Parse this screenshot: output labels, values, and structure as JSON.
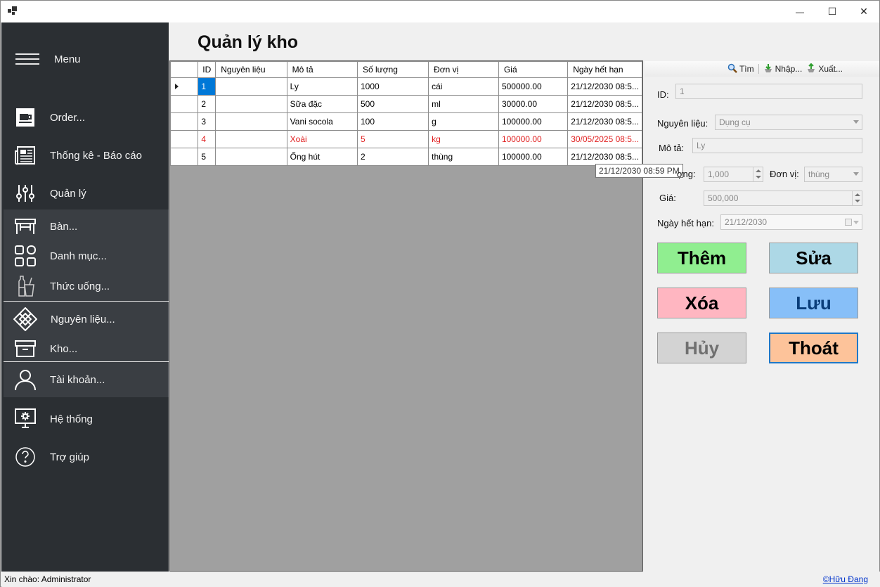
{
  "window": {
    "minimize": "—",
    "maximize": "☐",
    "close": "✕"
  },
  "sidebar": {
    "menu_label": "Menu",
    "items": [
      {
        "label": "Order...",
        "icon": "coffee-cup-icon"
      },
      {
        "label": "Thống kê - Báo cáo",
        "icon": "newspaper-icon"
      },
      {
        "label": "Quản lý",
        "icon": "sliders-icon"
      },
      {
        "label": "Bàn...",
        "icon": "table-icon"
      },
      {
        "label": "Danh mục...",
        "icon": "grid-apps-icon"
      },
      {
        "label": "Thức uống...",
        "icon": "drinks-icon"
      },
      {
        "label": "Nguyên liệu...",
        "icon": "ingredients-icon"
      },
      {
        "label": "Kho...",
        "icon": "archive-box-icon"
      },
      {
        "label": "Tài khoản...",
        "icon": "user-icon"
      },
      {
        "label": "Hệ thống",
        "icon": "system-monitor-icon"
      },
      {
        "label": "Trợ giúp",
        "icon": "help-circle-icon"
      }
    ]
  },
  "page_title": "Quản lý kho",
  "grid": {
    "columns": [
      "ID",
      "Nguyên liệu",
      "Mô tả",
      "Số lượng",
      "Đơn vị",
      "Giá",
      "Ngày hết hạn"
    ],
    "rows": [
      {
        "id": "1",
        "ingredient": "",
        "desc": "Ly",
        "qty": "1000",
        "unit": "cái",
        "price": "500000.00",
        "expiry": "21/12/2030 08:5...",
        "expired": false,
        "selected": true
      },
      {
        "id": "2",
        "ingredient": "",
        "desc": "Sữa đặc",
        "qty": "500",
        "unit": "ml",
        "price": "30000.00",
        "expiry": "21/12/2030 08:5...",
        "expired": false,
        "selected": false
      },
      {
        "id": "3",
        "ingredient": "",
        "desc": "Vani socola",
        "qty": "100",
        "unit": "g",
        "price": "100000.00",
        "expiry": "21/12/2030 08:5...",
        "expired": false,
        "selected": false
      },
      {
        "id": "4",
        "ingredient": "",
        "desc": "Xoài",
        "qty": "5",
        "unit": "kg",
        "price": "100000.00",
        "expiry": "30/05/2025 08:5...",
        "expired": true,
        "selected": false
      },
      {
        "id": "5",
        "ingredient": "",
        "desc": "Ống hút",
        "qty": "2",
        "unit": "thùng",
        "price": "100000.00",
        "expiry": "21/12/2030 08:5...",
        "expired": false,
        "selected": false
      }
    ],
    "tooltip": "21/12/2030 08:59 PM"
  },
  "toolbar": {
    "find": "Tìm",
    "import": "Nhập...",
    "export": "Xuất..."
  },
  "form": {
    "id_label": "ID:",
    "id_value": "1",
    "ingredient_label": "Nguyên liệu:",
    "ingredient_value": "Dụng cụ",
    "desc_label": "Mô tả:",
    "desc_value": "Ly",
    "qty_label": "ợng:",
    "qty_value": "1,000",
    "unit_label": "Đơn vị:",
    "unit_value": "thùng",
    "price_label": "Giá:",
    "price_value": "500,000",
    "expiry_label": "Ngày hết hạn:",
    "expiry_value": "21/12/2030"
  },
  "buttons": {
    "add": "Thêm",
    "edit": "Sửa",
    "delete": "Xóa",
    "save": "Lưu",
    "cancel": "Hủy",
    "exit": "Thoát"
  },
  "colors": {
    "add": "#90ee90",
    "edit": "#add8e6",
    "delete": "#ffb6c1",
    "save": "#87bff8",
    "cancel": "#d3d3d3",
    "exit": "#fdc39a",
    "sidebar": "#2b2f33",
    "expired_text": "#e02020",
    "selection": "#0078d7"
  },
  "status": {
    "greeting": "Xin chào: Administrator",
    "author": "©Hữu Đang"
  }
}
